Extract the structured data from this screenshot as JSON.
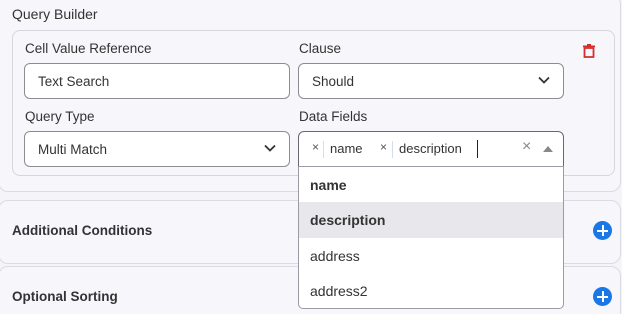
{
  "query_builder": {
    "title": "Query Builder",
    "cell_value_reference": {
      "label": "Cell Value Reference",
      "value": "Text Search"
    },
    "clause": {
      "label": "Clause",
      "value": "Should"
    },
    "query_type": {
      "label": "Query Type",
      "value": "Multi Match"
    },
    "data_fields": {
      "label": "Data Fields",
      "tags": [
        {
          "label": "name",
          "remove": "×"
        },
        {
          "label": "description",
          "remove": "×"
        }
      ],
      "clear": "×"
    }
  },
  "dropdown": {
    "options": [
      {
        "label": "name",
        "bold": true
      },
      {
        "label": "description",
        "bold": true,
        "highlighted": true
      },
      {
        "label": "address"
      },
      {
        "label": "address2"
      }
    ]
  },
  "additional_conditions": {
    "title": "Additional Conditions"
  },
  "optional_sorting": {
    "title": "Optional Sorting"
  },
  "colors": {
    "accent": "#1978e5",
    "danger": "#d32f2f"
  }
}
